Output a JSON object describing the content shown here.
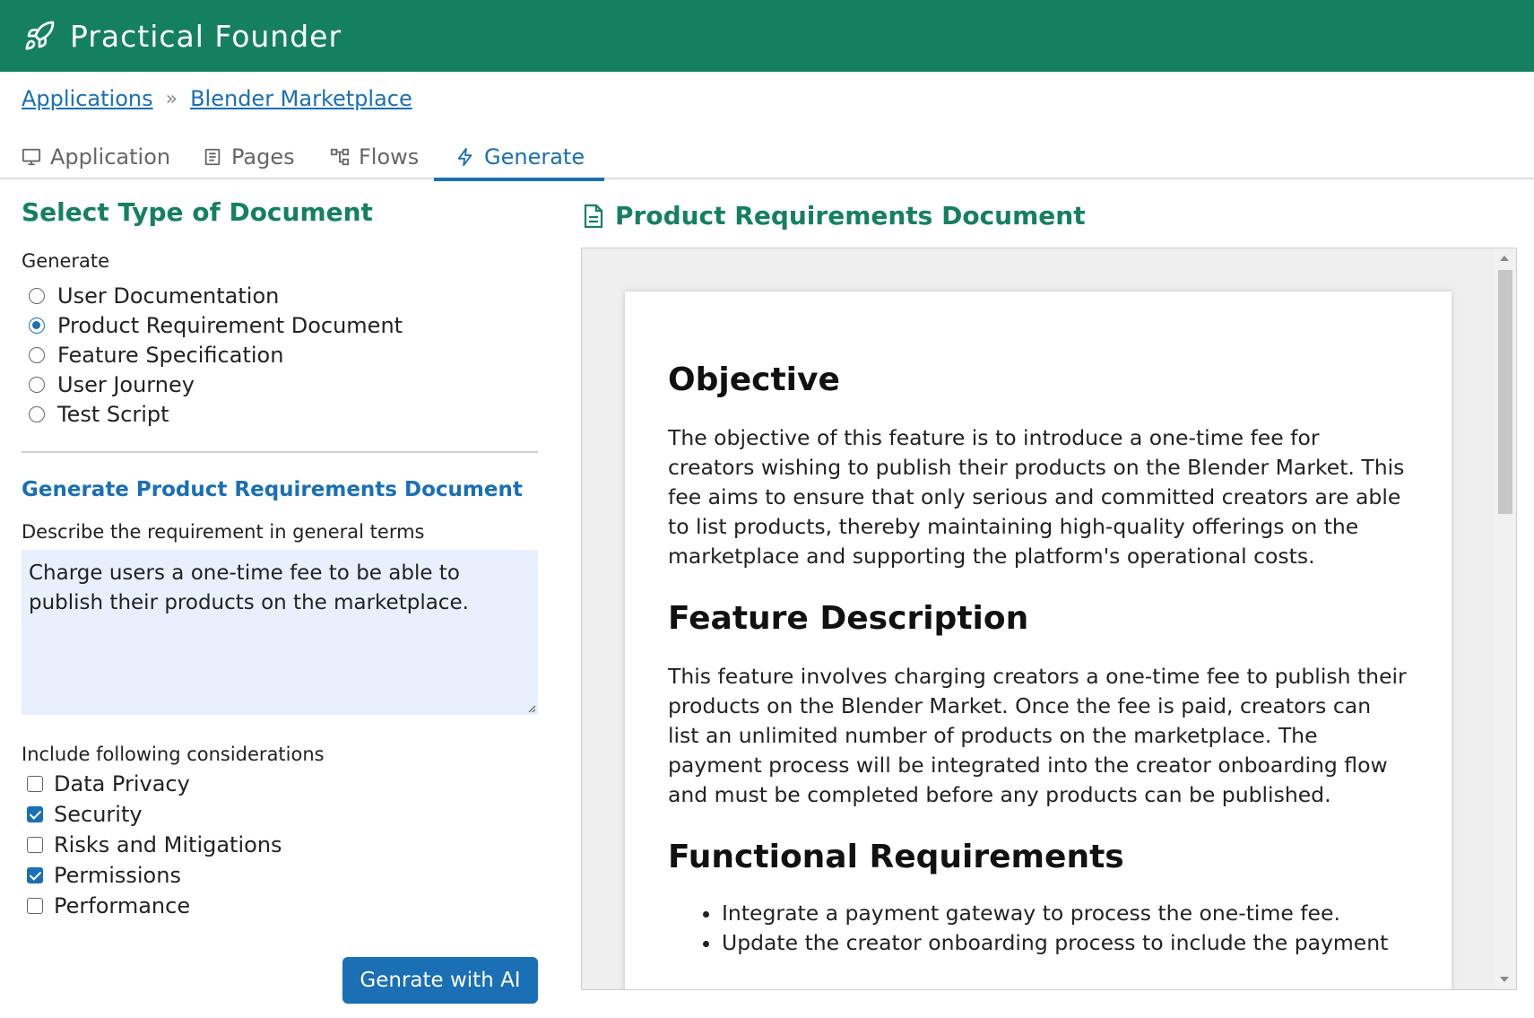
{
  "app": {
    "title": "Practical Founder",
    "brand_color": "#158060",
    "accent_color": "#1a6fb5",
    "logo_icon": "rocket-icon"
  },
  "breadcrumb": {
    "items": [
      "Applications",
      "Blender Marketplace"
    ],
    "separator": "»"
  },
  "tabs": [
    {
      "label": "Application",
      "icon": "monitor-icon"
    },
    {
      "label": "Pages",
      "icon": "document-list-icon"
    },
    {
      "label": "Flows",
      "icon": "flow-diagram-icon"
    },
    {
      "label": "Generate",
      "icon": "lightning-icon",
      "active": true
    }
  ],
  "left": {
    "title": "Select Type of Document",
    "generate_label": "Generate",
    "doc_types": [
      {
        "label": "User Documentation",
        "checked": false
      },
      {
        "label": "Product Requirement Document",
        "checked": true
      },
      {
        "label": "Feature Specification",
        "checked": false
      },
      {
        "label": "User Journey",
        "checked": false
      },
      {
        "label": "Test Script",
        "checked": false
      }
    ],
    "subtitle": "Generate Product Requirements Document",
    "describe_label": "Describe the requirement in general terms",
    "requirement_text": "Charge users a one-time fee to be able to publish their products on the marketplace.",
    "considerations_label": "Include following considerations",
    "considerations": [
      {
        "label": "Data Privacy",
        "checked": false
      },
      {
        "label": "Security",
        "checked": true
      },
      {
        "label": "Risks and Mitigations",
        "checked": false
      },
      {
        "label": "Permissions",
        "checked": true
      },
      {
        "label": "Performance",
        "checked": false
      }
    ],
    "generate_button": "Genrate with AI"
  },
  "right": {
    "title": "Product Requirements Document",
    "title_icon": "document-icon",
    "doc": {
      "objective_heading": "Objective",
      "objective_text": "The objective of this feature is to introduce a one-time fee for creators wishing to publish their products on the Blender Market. This fee aims to ensure that only serious and committed creators are able to list products, thereby maintaining high-quality offerings on the marketplace and supporting the platform's operational costs.",
      "feature_heading": "Feature Description",
      "feature_text": "This feature involves charging creators a one-time fee to publish their products on the Blender Market. Once the fee is paid, creators can list an unlimited number of products on the marketplace. The payment process will be integrated into the creator onboarding flow and must be completed before any products can be published.",
      "functional_heading": "Functional Requirements",
      "functional_items": [
        "Integrate a payment gateway to process the one-time fee.",
        "Update the creator onboarding process to include the payment"
      ]
    }
  }
}
